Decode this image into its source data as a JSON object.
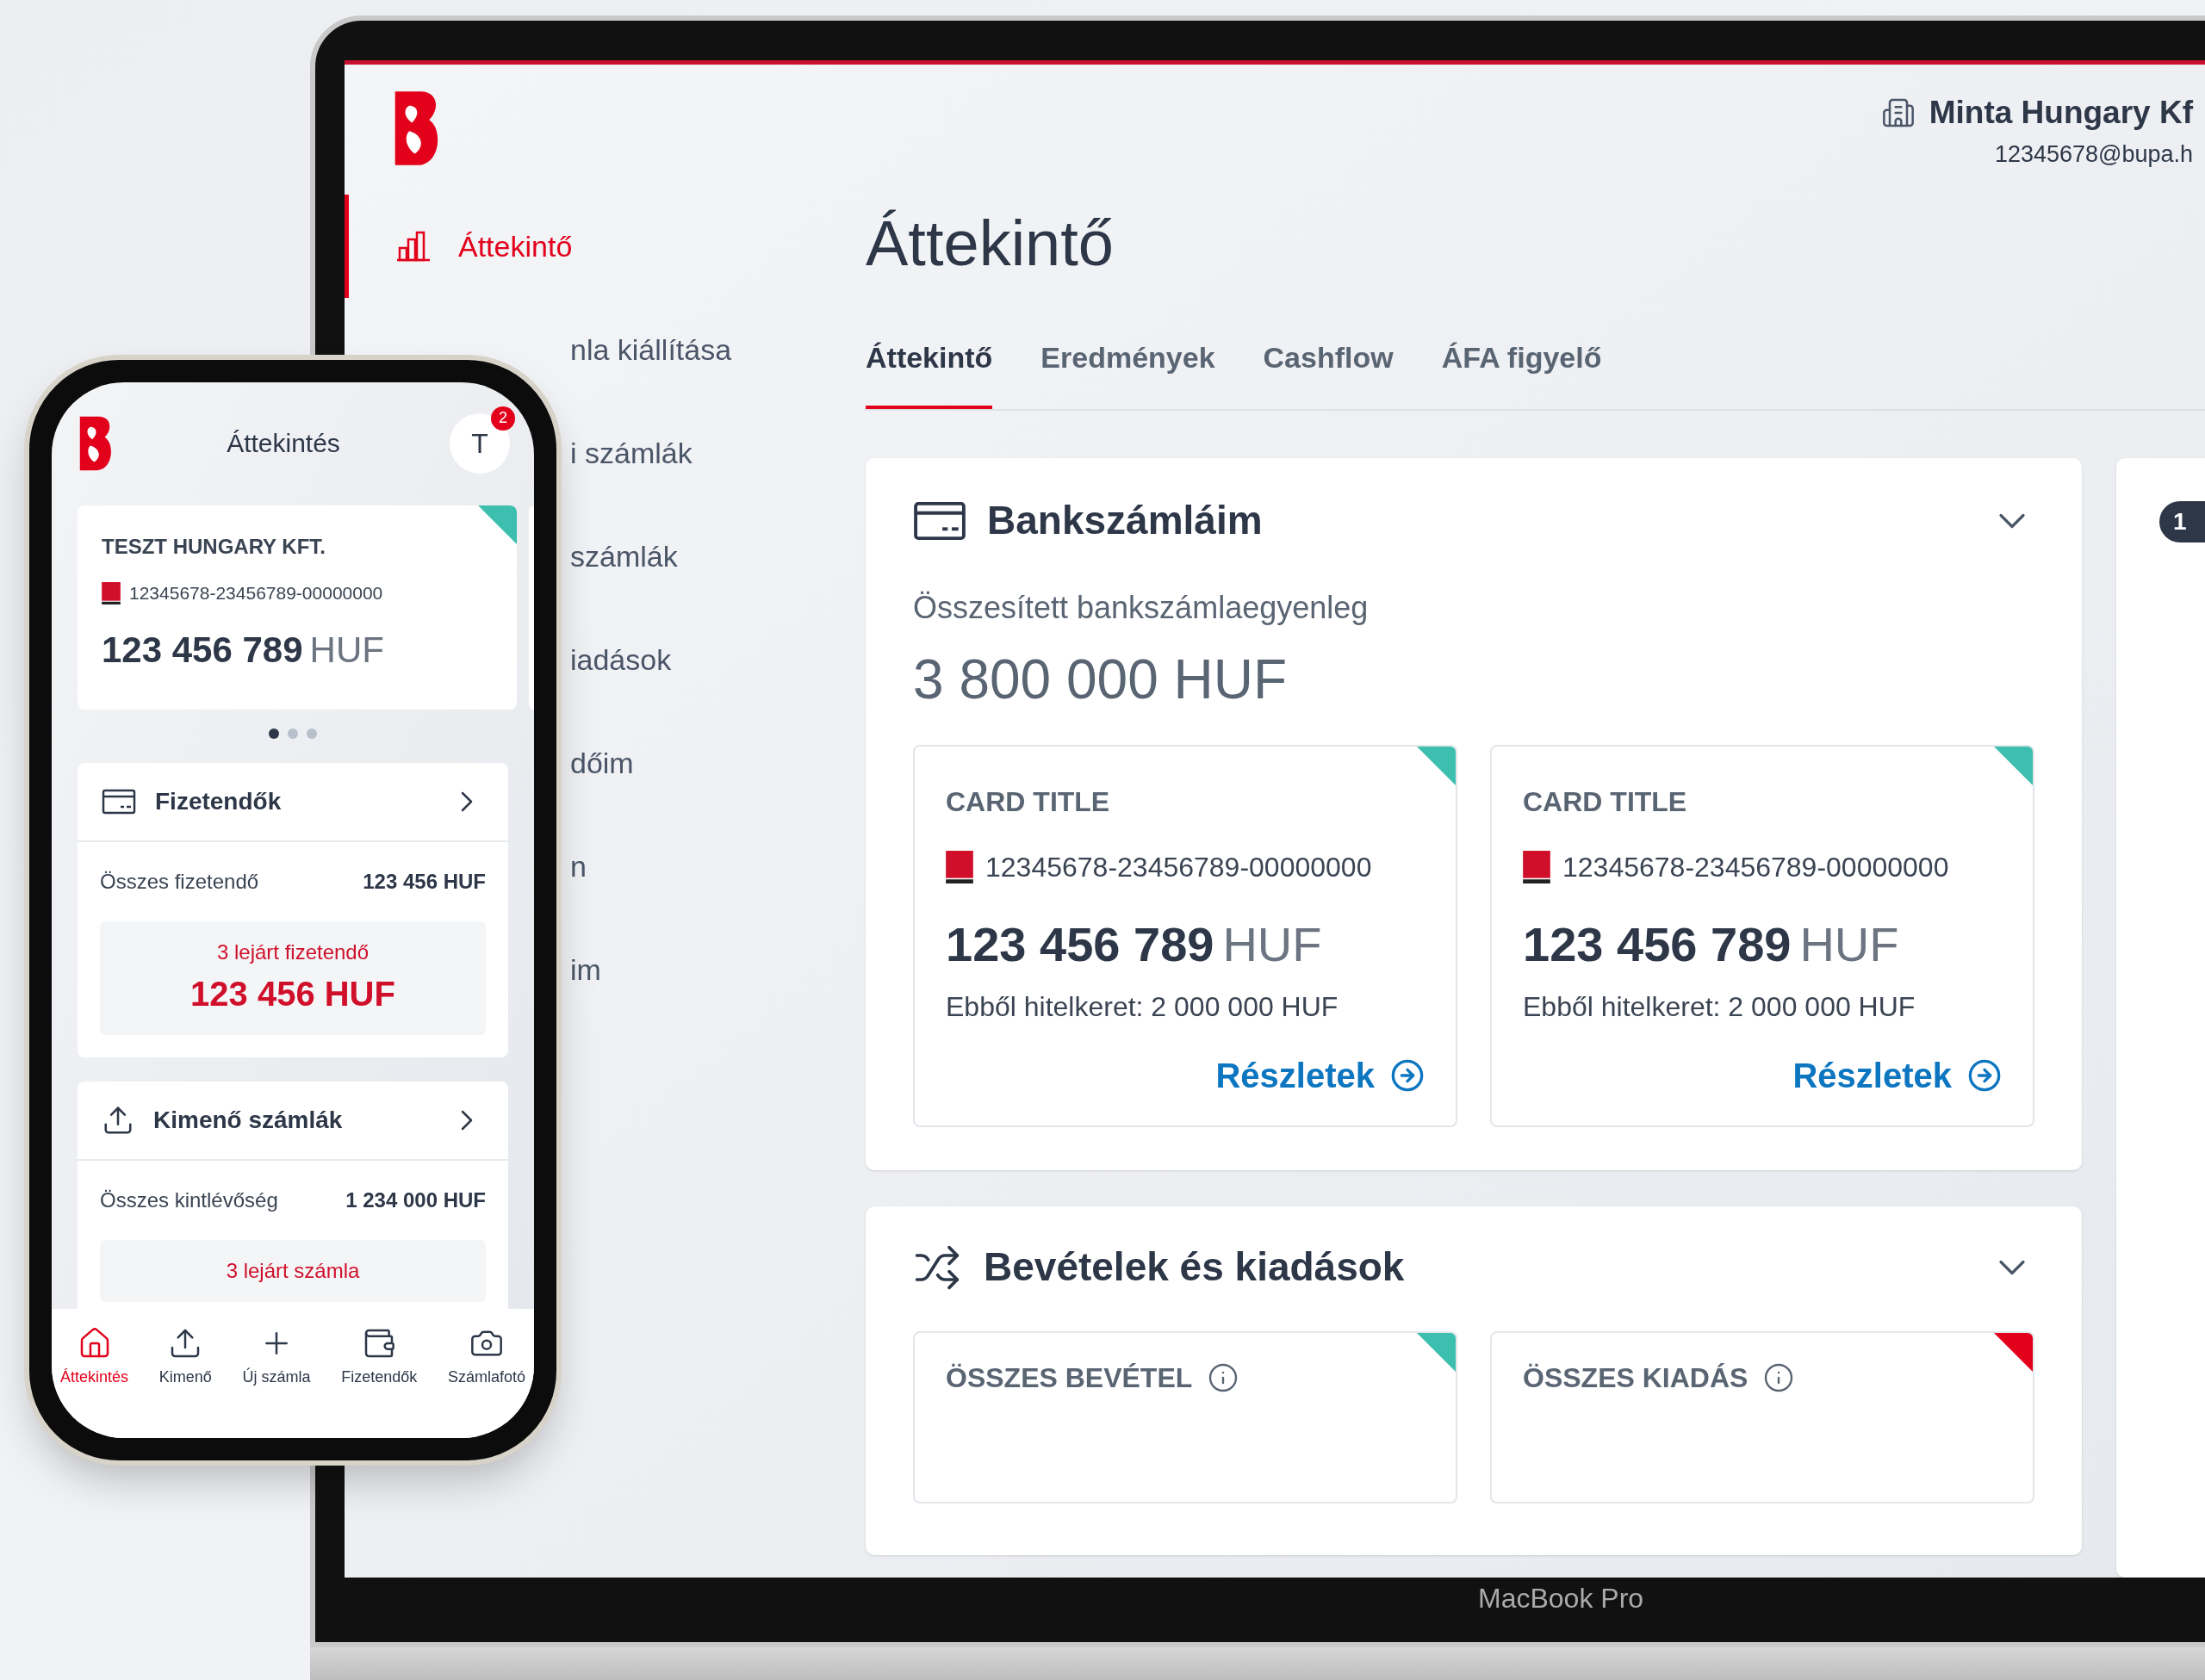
{
  "laptop": {
    "brand_label": "MacBook Pro",
    "header": {
      "company": "Minta Hungary Kf",
      "email": "12345678@bupa.h"
    },
    "sidebar": {
      "items": [
        {
          "label": "Áttekintő",
          "selected": true
        },
        {
          "label": "nla kiállítása",
          "selected": false
        },
        {
          "label": "i számlák",
          "selected": false
        },
        {
          "label": "számlák",
          "selected": false
        },
        {
          "label": "iadások",
          "selected": false
        },
        {
          "label": "dőim",
          "selected": false
        },
        {
          "label": "n",
          "selected": false
        },
        {
          "label": "im",
          "selected": false
        }
      ]
    },
    "page_title": "Áttekintő",
    "tabs": [
      {
        "label": "Áttekintő",
        "selected": true
      },
      {
        "label": "Eredmények",
        "selected": false
      },
      {
        "label": "Cashflow",
        "selected": false
      },
      {
        "label": "ÁFA figyelő",
        "selected": false
      }
    ],
    "bank_panel": {
      "title": "Bankszámláim",
      "total_label": "Összesített bankszámlaegyenleg",
      "total_value": "3 800 000 HUF",
      "cards": [
        {
          "title": "CARD TITLE",
          "account": "12345678-23456789-00000000",
          "amount": "123 456 789",
          "currency": "HUF",
          "credit_line": "Ebből hitelkeret: 2 000 000 HUF",
          "link": "Részletek",
          "color": "#3cbfae"
        },
        {
          "title": "CARD TITLE",
          "account": "12345678-23456789-00000000",
          "amount": "123 456 789",
          "currency": "HUF",
          "credit_line": "Ebből hitelkeret: 2 000 000 HUF",
          "link": "Részletek",
          "color": "#3cbfae"
        }
      ]
    },
    "cashflow_panel": {
      "title": "Bevételek és kiadások",
      "cards": [
        {
          "title": "ÖSSZES BEVÉTEL",
          "color": "#3cbfae"
        },
        {
          "title": "ÖSSZES KIADÁS",
          "color": "#e2001a"
        }
      ]
    },
    "side_panel": {
      "badge": "1"
    }
  },
  "phone": {
    "title": "Áttekintés",
    "avatar": "T",
    "notification_count": "2",
    "account_card": {
      "company": "TESZT HUNGARY KFT.",
      "account": "12345678-23456789-00000000",
      "amount": "123 456 789",
      "currency": "HUF",
      "color": "#3cbfae"
    },
    "carousel_dots": [
      {
        "selected": true
      },
      {
        "selected": false
      },
      {
        "selected": false
      }
    ],
    "sections": [
      {
        "kind": "card",
        "title": "Fizetendők",
        "row_label": "Összes fizetendő",
        "row_value": "123 456 HUF",
        "overdue_label": "3 lejárt fizetendő",
        "overdue_value": "123 456 HUF"
      },
      {
        "kind": "upload",
        "title": "Kimenő számlák",
        "row_label": "Összes kintlévőség",
        "row_value": "1 234 000 HUF",
        "overdue_label": "3 lejárt számla"
      }
    ],
    "nav": [
      {
        "kind": "home",
        "label": "Áttekintés",
        "selected": true
      },
      {
        "kind": "upload",
        "label": "Kimenő",
        "selected": false
      },
      {
        "kind": "plus",
        "label": "Új számla",
        "selected": false
      },
      {
        "kind": "wallet",
        "label": "Fizetendők",
        "selected": false
      },
      {
        "kind": "camera",
        "label": "Számlafotó",
        "selected": false
      }
    ]
  }
}
